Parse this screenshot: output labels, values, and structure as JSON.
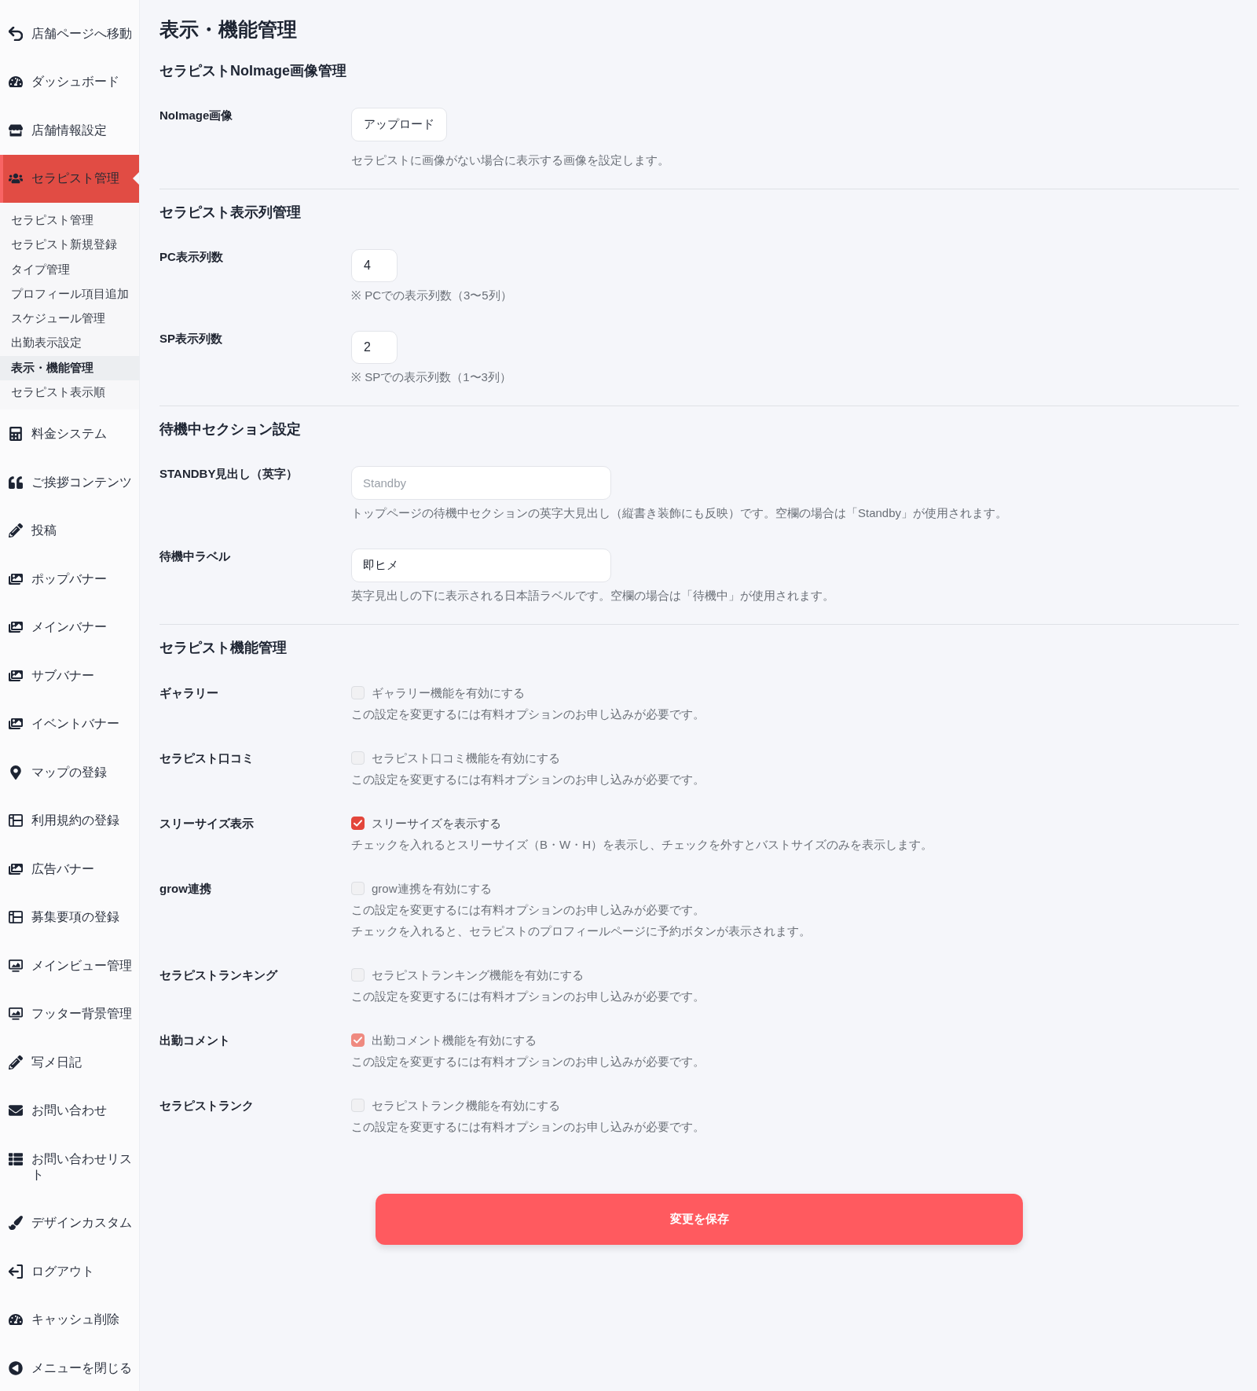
{
  "sidebar": {
    "items": [
      {
        "label": "店舗ページへ移動",
        "selected": false
      },
      {
        "label": "ダッシュボード",
        "selected": false
      },
      {
        "label": "店舗情報設定",
        "selected": false
      },
      {
        "label": "セラピスト管理",
        "selected": true,
        "children": [
          {
            "label": "セラピスト管理",
            "selected": false
          },
          {
            "label": "セラピスト新規登録",
            "selected": false
          },
          {
            "label": "タイプ管理",
            "selected": false
          },
          {
            "label": "プロフィール項目追加",
            "selected": false
          },
          {
            "label": "スケジュール管理",
            "selected": false
          },
          {
            "label": "出勤表示設定",
            "selected": false
          },
          {
            "label": "表示・機能管理",
            "selected": true
          },
          {
            "label": "セラピスト表示順",
            "selected": false
          }
        ]
      },
      {
        "label": "料金システム",
        "selected": false
      },
      {
        "label": "ご挨拶コンテンツ",
        "selected": false
      },
      {
        "label": "投稿",
        "selected": false
      },
      {
        "label": "ポップバナー",
        "selected": false
      },
      {
        "label": "メインバナー",
        "selected": false
      },
      {
        "label": "サブバナー",
        "selected": false
      },
      {
        "label": "イベントバナー",
        "selected": false
      },
      {
        "label": "マップの登録",
        "selected": false
      },
      {
        "label": "利用規約の登録",
        "selected": false
      },
      {
        "label": "広告バナー",
        "selected": false
      },
      {
        "label": "募集要項の登録",
        "selected": false
      },
      {
        "label": "メインビュー管理",
        "selected": false
      },
      {
        "label": "フッター背景管理",
        "selected": false
      },
      {
        "label": "写メ日記",
        "selected": false
      },
      {
        "label": "お問い合わせ",
        "selected": false
      },
      {
        "label": "お問い合わせリスト",
        "selected": false
      },
      {
        "label": "デザインカスタム",
        "selected": false
      },
      {
        "label": "ログアウト",
        "selected": false
      },
      {
        "label": "キャッシュ削除",
        "selected": false
      },
      {
        "label": "メニューを閉じる",
        "selected": false
      }
    ]
  },
  "title": "表示・機能管理",
  "sections": [
    {
      "heading": "セラピストNoImage画像管理",
      "rows": [
        {
          "kind": "upload",
          "label": "NoImage画像",
          "button": "アップロード",
          "notes": [
            "セラピストに画像がない場合に表示する画像を設定します。"
          ]
        }
      ]
    },
    {
      "heading": "セラピスト表示列管理",
      "rows": [
        {
          "kind": "number",
          "label": "PC表示列数",
          "value": "4",
          "notes": [
            "※ PCでの表示列数（3〜5列）"
          ]
        },
        {
          "kind": "number",
          "label": "SP表示列数",
          "value": "2",
          "notes": [
            "※ SPでの表示列数（1〜3列）"
          ]
        }
      ]
    },
    {
      "heading": "待機中セクション設定",
      "rows": [
        {
          "kind": "text",
          "label": "STANDBY見出し（英字）",
          "placeholder": "Standby",
          "notes": [
            "トップページの待機中セクションの英字大見出し（縦書き装飾にも反映）です。空欄の場合は「Standby」が使用されます。"
          ]
        },
        {
          "kind": "text",
          "label": "待機中ラベル",
          "value": "即ヒメ",
          "notes": [
            "英字見出しの下に表示される日本語ラベルです。空欄の場合は「待機中」が使用されます。"
          ]
        }
      ]
    },
    {
      "heading": "セラピスト機能管理",
      "rows": [
        {
          "kind": "checkbox",
          "label": "ギャラリー",
          "option": "ギャラリー機能を有効にする",
          "checked": false,
          "disabled": true,
          "notes": [
            "この設定を変更するには有料オプションのお申し込みが必要です。"
          ]
        },
        {
          "kind": "checkbox",
          "label": "セラピスト口コミ",
          "option": "セラピスト口コミ機能を有効にする",
          "checked": false,
          "disabled": true,
          "notes": [
            "この設定を変更するには有料オプションのお申し込みが必要です。"
          ]
        },
        {
          "kind": "checkbox",
          "label": "スリーサイズ表示",
          "option": "スリーサイズを表示する",
          "checked": true,
          "disabled": false,
          "notes": [
            "チェックを入れるとスリーサイズ（B・W・H）を表示し、チェックを外すとバストサイズのみを表示します。"
          ]
        },
        {
          "kind": "checkbox",
          "label": "grow連携",
          "option": "grow連携を有効にする",
          "checked": false,
          "disabled": true,
          "notes": [
            "この設定を変更するには有料オプションのお申し込みが必要です。",
            "チェックを入れると、セラピストのプロフィールページに予約ボタンが表示されます。"
          ]
        },
        {
          "kind": "checkbox",
          "label": "セラピストランキング",
          "option": "セラピストランキング機能を有効にする",
          "checked": false,
          "disabled": true,
          "notes": [
            "この設定を変更するには有料オプションのお申し込みが必要です。"
          ]
        },
        {
          "kind": "checkbox",
          "label": "出勤コメント",
          "option": "出勤コメント機能を有効にする",
          "checked": true,
          "disabled": true,
          "notes": [
            "この設定を変更するには有料オプションのお申し込みが必要です。"
          ]
        },
        {
          "kind": "checkbox",
          "label": "セラピストランク",
          "option": "セラピストランク機能を有効にする",
          "checked": false,
          "disabled": true,
          "notes": [
            "この設定を変更するには有料オプションのお申し込みが必要です。"
          ]
        }
      ]
    }
  ],
  "save_button": "変更を保存"
}
